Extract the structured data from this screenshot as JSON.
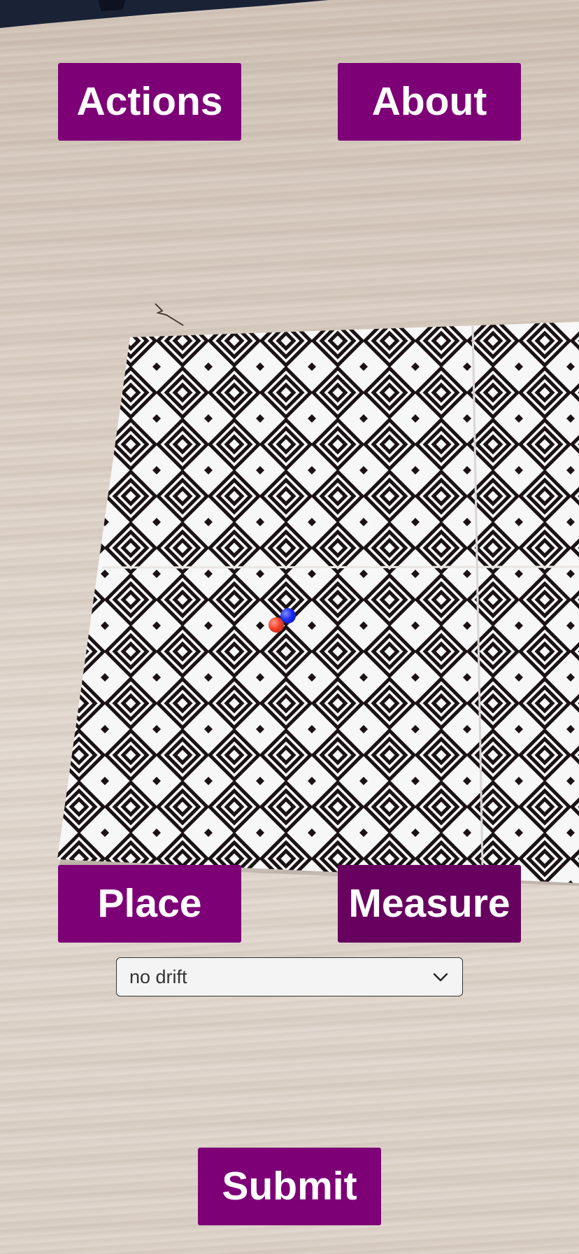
{
  "buttons": {
    "actions_label": "Actions",
    "about_label": "About",
    "place_label": "Place",
    "measure_label": "Measure",
    "submit_label": "Submit"
  },
  "drift_select": {
    "selected": "no drift",
    "icon": "chevron-down-icon"
  },
  "scene": {
    "markers": [
      {
        "name": "red-marker",
        "color": "#f0402a"
      },
      {
        "name": "blue-marker",
        "color": "#1b2bf0"
      }
    ]
  },
  "colors": {
    "button_bg": "#7d0077",
    "button_pressed_bg": "#68005f",
    "button_text": "#ffffff",
    "select_bg": "#f4f4f4"
  }
}
